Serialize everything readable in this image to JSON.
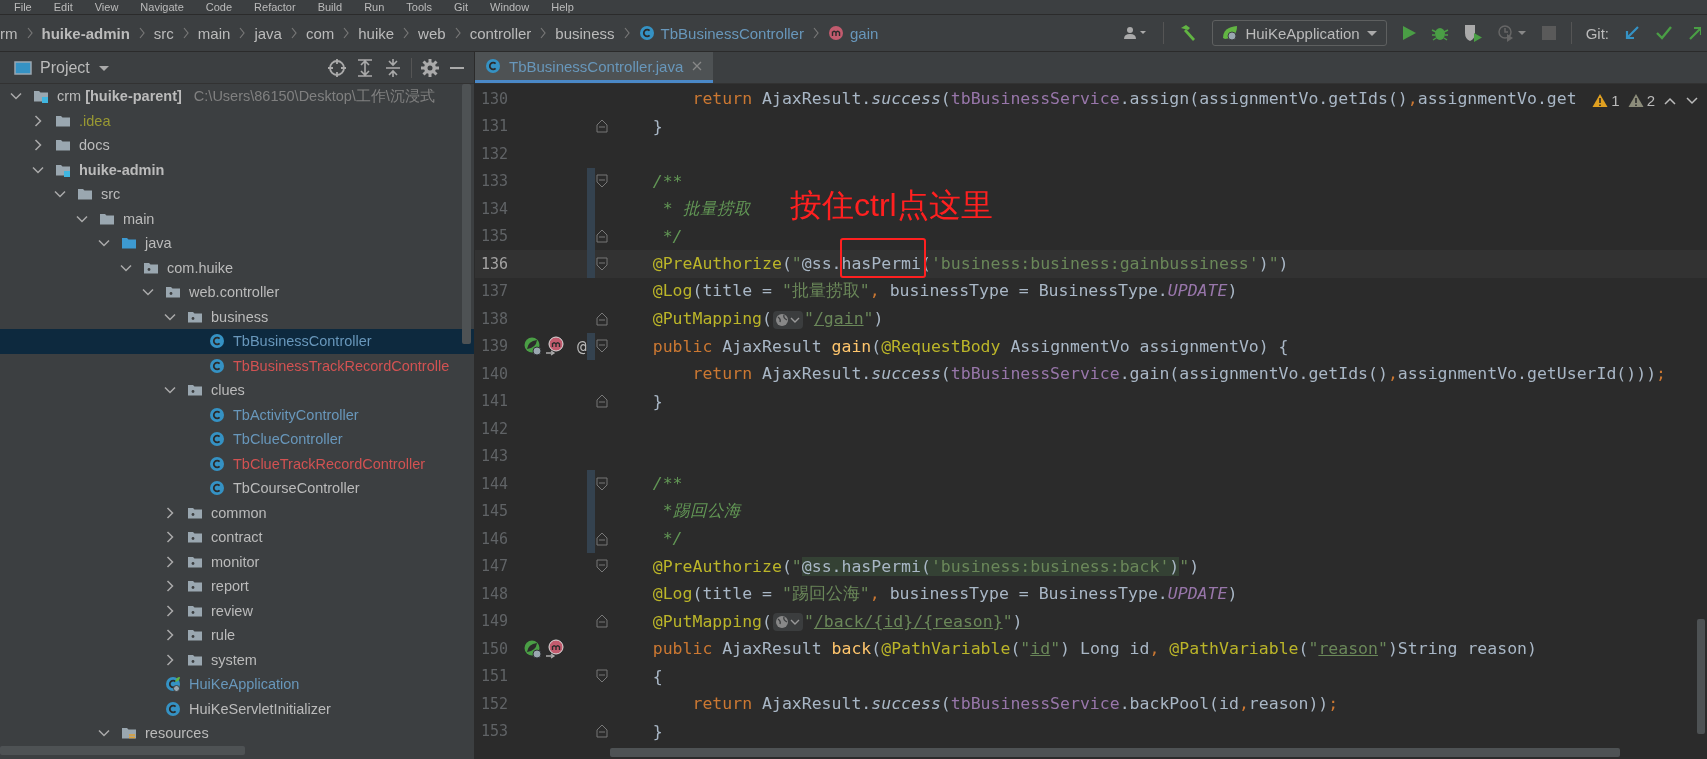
{
  "menu_bar": [
    "File",
    "Edit",
    "View",
    "Navigate",
    "Code",
    "Refactor",
    "Build",
    "Run",
    "Tools",
    "Git",
    "Window",
    "Help"
  ],
  "breadcrumbs": [
    {
      "label": "rm",
      "kind": "plain"
    },
    {
      "label": "huike-admin",
      "kind": "bold"
    },
    {
      "label": "src",
      "kind": "plain"
    },
    {
      "label": "main",
      "kind": "plain"
    },
    {
      "label": "java",
      "kind": "plain"
    },
    {
      "label": "com",
      "kind": "plain"
    },
    {
      "label": "huike",
      "kind": "plain"
    },
    {
      "label": "web",
      "kind": "plain"
    },
    {
      "label": "controller",
      "kind": "plain"
    },
    {
      "label": "business",
      "kind": "plain"
    },
    {
      "label": "TbBusinessController",
      "kind": "class"
    },
    {
      "label": "gain",
      "kind": "method"
    }
  ],
  "toolbar": {
    "run_configuration": "HuiKeApplication",
    "git_label": "Git:"
  },
  "project_panel": {
    "title": "Project",
    "tree": [
      {
        "label": "crm **[huike-parent]**",
        "path": "C:\\Users\\86150\\Desktop\\工作\\沉浸式",
        "kind": "root-module",
        "color": "#bbbbbb",
        "selected": false,
        "expanded": true,
        "children": [
          {
            "label": ".idea",
            "kind": "folder",
            "color": "#999933",
            "selected": false,
            "expanded": false
          },
          {
            "label": "docs",
            "kind": "folder",
            "color": "#bbbbbb",
            "selected": false,
            "expanded": false
          },
          {
            "label": "huike-admin",
            "kind": "module",
            "color": "#bbbbbb",
            "selected": false,
            "expanded": true,
            "children": [
              {
                "label": "src",
                "kind": "folder",
                "color": "#bbbbbb",
                "selected": false,
                "expanded": true,
                "children": [
                  {
                    "label": "main",
                    "kind": "folder",
                    "color": "#bbbbbb",
                    "selected": false,
                    "expanded": true,
                    "children": [
                      {
                        "label": "java",
                        "kind": "source-folder",
                        "color": "#bbbbbb",
                        "selected": false,
                        "expanded": true,
                        "children": [
                          {
                            "label": "com.huike",
                            "kind": "package",
                            "color": "#bbbbbb",
                            "selected": false,
                            "expanded": true,
                            "children": [
                              {
                                "label": "web.controller",
                                "kind": "package",
                                "color": "#bbbbbb",
                                "selected": false,
                                "expanded": true,
                                "children": [
                                  {
                                    "label": "business",
                                    "kind": "package",
                                    "color": "#bbbbbb",
                                    "selected": false,
                                    "expanded": true,
                                    "children": [
                                      {
                                        "label": "TbBusinessController",
                                        "kind": "class",
                                        "color": "#6897bb",
                                        "selected": true
                                      },
                                      {
                                        "label": "TbBusinessTrackRecordControlle",
                                        "kind": "class",
                                        "color": "#d25252",
                                        "selected": false
                                      }
                                    ]
                                  },
                                  {
                                    "label": "clues",
                                    "kind": "package",
                                    "color": "#bbbbbb",
                                    "selected": false,
                                    "expanded": true,
                                    "children": [
                                      {
                                        "label": "TbActivityController",
                                        "kind": "class",
                                        "color": "#6897bb",
                                        "selected": false
                                      },
                                      {
                                        "label": "TbClueController",
                                        "kind": "class",
                                        "color": "#6897bb",
                                        "selected": false
                                      },
                                      {
                                        "label": "TbClueTrackRecordController",
                                        "kind": "class",
                                        "color": "#d25252",
                                        "selected": false
                                      },
                                      {
                                        "label": "TbCourseController",
                                        "kind": "class",
                                        "color": "#bbbbbb",
                                        "selected": false
                                      }
                                    ]
                                  },
                                  {
                                    "label": "common",
                                    "kind": "package",
                                    "color": "#bbbbbb",
                                    "selected": false,
                                    "expanded": false
                                  },
                                  {
                                    "label": "contract",
                                    "kind": "package",
                                    "color": "#bbbbbb",
                                    "selected": false,
                                    "expanded": false
                                  },
                                  {
                                    "label": "monitor",
                                    "kind": "package",
                                    "color": "#bbbbbb",
                                    "selected": false,
                                    "expanded": false
                                  },
                                  {
                                    "label": "report",
                                    "kind": "package",
                                    "color": "#bbbbbb",
                                    "selected": false,
                                    "expanded": false
                                  },
                                  {
                                    "label": "review",
                                    "kind": "package",
                                    "color": "#bbbbbb",
                                    "selected": false,
                                    "expanded": false
                                  },
                                  {
                                    "label": "rule",
                                    "kind": "package",
                                    "color": "#bbbbbb",
                                    "selected": false,
                                    "expanded": false
                                  },
                                  {
                                    "label": "system",
                                    "kind": "package",
                                    "color": "#bbbbbb",
                                    "selected": false,
                                    "expanded": false
                                  }
                                ]
                              },
                              {
                                "label": "HuiKeApplication",
                                "kind": "boot-class",
                                "color": "#6897bb",
                                "selected": false
                              },
                              {
                                "label": "HuiKeServletInitializer",
                                "kind": "class",
                                "color": "#bbbbbb",
                                "selected": false
                              }
                            ]
                          }
                        ]
                      },
                      {
                        "label": "resources",
                        "kind": "resources-folder",
                        "color": "#bbbbbb",
                        "selected": false,
                        "expanded": true
                      }
                    ]
                  }
                ]
              }
            ]
          }
        ]
      }
    ]
  },
  "editor": {
    "tabs": [
      {
        "label": "TbBusinessController.java",
        "selected": true
      }
    ],
    "inspections": [
      {
        "count": "1",
        "kind": "warning"
      },
      {
        "count": "2",
        "kind": "weak"
      }
    ],
    "lines": [
      {
        "number": "130",
        "kind": "plain",
        "changed": false,
        "current": false,
        "code": [
          {
            "t": "        return ",
            "kind": "kw"
          },
          {
            "t": "AjaxResult.",
            "kind": "plain"
          },
          {
            "t": "success",
            "kind": "ital"
          },
          {
            "t": "(",
            "kind": "plain"
          },
          {
            "t": "tbBusinessService",
            "kind": "field"
          },
          {
            "t": ".assign(assignmentVo.getIds()",
            "kind": "plain"
          },
          {
            "t": ",",
            "kind": "punct"
          },
          {
            "t": "assignmentVo.get",
            "kind": "plain"
          }
        ]
      },
      {
        "number": "131",
        "kind": "fold-end",
        "changed": false,
        "current": false,
        "code": [
          {
            "t": "    }",
            "kind": "plain"
          }
        ]
      },
      {
        "number": "132",
        "kind": "plain",
        "changed": false,
        "current": false
      },
      {
        "number": "133",
        "kind": "fold-start",
        "changed": true,
        "current": false,
        "code": [
          {
            "t": "    /**",
            "kind": "doc"
          }
        ]
      },
      {
        "number": "134",
        "kind": "plain",
        "changed": true,
        "current": false,
        "code": [
          {
            "t": "     * 批量捞取",
            "kind": "doc"
          }
        ]
      },
      {
        "number": "135",
        "kind": "fold-end",
        "changed": true,
        "current": false,
        "code": [
          {
            "t": "     */",
            "kind": "doc"
          }
        ]
      },
      {
        "number": "136",
        "kind": "fold-start",
        "changed": true,
        "current": true,
        "code": [
          {
            "t": "    @PreAuthorize",
            "kind": "ann"
          },
          {
            "t": "(",
            "kind": "plain"
          },
          {
            "t": "\"",
            "kind": "str"
          },
          {
            "t": "@ss.hasPermi(",
            "kind": "spel"
          },
          {
            "t": "'business:business:gainbussiness'",
            "kind": "str"
          },
          {
            "t": ")",
            "kind": "spel"
          },
          {
            "t": "\"",
            "kind": "str"
          },
          {
            "t": ")",
            "kind": "plain"
          }
        ]
      },
      {
        "number": "137",
        "kind": "plain",
        "changed": false,
        "current": false,
        "code": [
          {
            "t": "    @Log",
            "kind": "ann"
          },
          {
            "t": "(title = ",
            "kind": "plain"
          },
          {
            "t": "\"批量捞取\"",
            "kind": "str"
          },
          {
            "t": ", ",
            "kind": "punct"
          },
          {
            "t": "businessType = BusinessType.",
            "kind": "plain"
          },
          {
            "t": "UPDATE",
            "kind": "const"
          },
          {
            "t": ")",
            "kind": "plain"
          }
        ]
      },
      {
        "number": "138",
        "kind": "fold-end",
        "changed": false,
        "current": false,
        "url_inlay": true,
        "code": [
          {
            "t": "    @PutMapping",
            "kind": "ann"
          },
          {
            "t": "(",
            "kind": "plain"
          },
          {
            "t": "\"",
            "kind": "str"
          },
          {
            "t": "/gain",
            "kind": "link"
          },
          {
            "t": "\"",
            "kind": "str"
          },
          {
            "t": ")",
            "kind": "plain"
          }
        ]
      },
      {
        "number": "139",
        "kind": "fold-start",
        "changed": true,
        "current": false,
        "gutter": [
          {
            "kind": "bean"
          },
          {
            "kind": "mapping"
          }
        ],
        "gutter_text": "@",
        "code": [
          {
            "t": "    public ",
            "kind": "kw"
          },
          {
            "t": "AjaxResult ",
            "kind": "plain"
          },
          {
            "t": "gain",
            "kind": "decl"
          },
          {
            "t": "(",
            "kind": "plain"
          },
          {
            "t": "@RequestBody",
            "kind": "ann"
          },
          {
            "t": " AssignmentVo assignmentVo) {",
            "kind": "plain"
          }
        ]
      },
      {
        "number": "140",
        "kind": "plain",
        "changed": false,
        "current": false,
        "code": [
          {
            "t": "        return ",
            "kind": "kw"
          },
          {
            "t": "AjaxResult.",
            "kind": "plain"
          },
          {
            "t": "success",
            "kind": "ital"
          },
          {
            "t": "(",
            "kind": "plain"
          },
          {
            "t": "tbBusinessService",
            "kind": "field"
          },
          {
            "t": ".gain(assignmentVo.getIds()",
            "kind": "plain"
          },
          {
            "t": ",",
            "kind": "punct"
          },
          {
            "t": "assignmentVo.getUserId()))",
            "kind": "plain"
          },
          {
            "t": ";",
            "kind": "punct"
          }
        ]
      },
      {
        "number": "141",
        "kind": "fold-end",
        "changed": false,
        "current": false,
        "code": [
          {
            "t": "    }",
            "kind": "plain"
          }
        ]
      },
      {
        "number": "142",
        "kind": "plain",
        "changed": false,
        "current": false
      },
      {
        "number": "143",
        "kind": "plain",
        "changed": false,
        "current": false
      },
      {
        "number": "144",
        "kind": "fold-start",
        "changed": true,
        "current": false,
        "code": [
          {
            "t": "    /**",
            "kind": "doc"
          }
        ]
      },
      {
        "number": "145",
        "kind": "plain",
        "changed": true,
        "current": false,
        "code": [
          {
            "t": "     *踢回公海",
            "kind": "doc"
          }
        ]
      },
      {
        "number": "146",
        "kind": "fold-end",
        "changed": true,
        "current": false,
        "code": [
          {
            "t": "     */",
            "kind": "doc"
          }
        ]
      },
      {
        "number": "147",
        "kind": "fold-start",
        "changed": false,
        "current": false,
        "code": [
          {
            "t": "    @PreAuthorize",
            "kind": "ann"
          },
          {
            "t": "(",
            "kind": "plain"
          },
          {
            "t": "\"",
            "kind": "str"
          },
          {
            "t": "@ss.hasPermi(",
            "kind": "spel-hl"
          },
          {
            "t": "'business:business:back'",
            "kind": "str-hl"
          },
          {
            "t": ")",
            "kind": "spel-hl"
          },
          {
            "t": "\"",
            "kind": "str"
          },
          {
            "t": ")",
            "kind": "plain"
          }
        ]
      },
      {
        "number": "148",
        "kind": "plain",
        "changed": false,
        "current": false,
        "code": [
          {
            "t": "    @Log",
            "kind": "ann"
          },
          {
            "t": "(title = ",
            "kind": "plain"
          },
          {
            "t": "\"踢回公海\"",
            "kind": "str"
          },
          {
            "t": ", ",
            "kind": "punct"
          },
          {
            "t": "businessType = BusinessType.",
            "kind": "plain"
          },
          {
            "t": "UPDATE",
            "kind": "const"
          },
          {
            "t": ")",
            "kind": "plain"
          }
        ]
      },
      {
        "number": "149",
        "kind": "fold-end",
        "changed": false,
        "current": false,
        "url_inlay": true,
        "code": [
          {
            "t": "    @PutMapping",
            "kind": "ann"
          },
          {
            "t": "(",
            "kind": "plain"
          },
          {
            "t": "\"",
            "kind": "str"
          },
          {
            "t": "/back/{id}/{reason}",
            "kind": "link"
          },
          {
            "t": "\"",
            "kind": "str"
          },
          {
            "t": ")",
            "kind": "plain"
          }
        ]
      },
      {
        "number": "150",
        "kind": "plain",
        "changed": false,
        "current": false,
        "gutter": [
          {
            "kind": "bean"
          },
          {
            "kind": "mapping"
          }
        ],
        "code": [
          {
            "t": "    public ",
            "kind": "kw"
          },
          {
            "t": "AjaxResult ",
            "kind": "plain"
          },
          {
            "t": "back",
            "kind": "decl"
          },
          {
            "t": "(",
            "kind": "plain"
          },
          {
            "t": "@PathVariable",
            "kind": "ann"
          },
          {
            "t": "(",
            "kind": "plain"
          },
          {
            "t": "\"",
            "kind": "str"
          },
          {
            "t": "id",
            "kind": "link"
          },
          {
            "t": "\"",
            "kind": "str"
          },
          {
            "t": ") Long id",
            "kind": "plain"
          },
          {
            "t": ", ",
            "kind": "punct"
          },
          {
            "t": "@PathVariable",
            "kind": "ann"
          },
          {
            "t": "(",
            "kind": "plain"
          },
          {
            "t": "\"",
            "kind": "str"
          },
          {
            "t": "reason",
            "kind": "link"
          },
          {
            "t": "\"",
            "kind": "str"
          },
          {
            "t": ")String reason)",
            "kind": "plain"
          }
        ]
      },
      {
        "number": "151",
        "kind": "fold-start",
        "changed": false,
        "current": false,
        "code": [
          {
            "t": "    {",
            "kind": "plain"
          }
        ]
      },
      {
        "number": "152",
        "kind": "plain",
        "changed": false,
        "current": false,
        "code": [
          {
            "t": "        return ",
            "kind": "kw"
          },
          {
            "t": "AjaxResult.",
            "kind": "plain"
          },
          {
            "t": "success",
            "kind": "ital"
          },
          {
            "t": "(",
            "kind": "plain"
          },
          {
            "t": "tbBusinessService",
            "kind": "field"
          },
          {
            "t": ".backPool(id",
            "kind": "plain"
          },
          {
            "t": ",",
            "kind": "punct"
          },
          {
            "t": "reason))",
            "kind": "plain"
          },
          {
            "t": ";",
            "kind": "punct"
          }
        ]
      },
      {
        "number": "153",
        "kind": "fold-end",
        "changed": false,
        "current": false,
        "code": [
          {
            "t": "    }",
            "kind": "plain"
          }
        ]
      }
    ]
  },
  "annotation": {
    "text": "按住ctrl点这里"
  }
}
